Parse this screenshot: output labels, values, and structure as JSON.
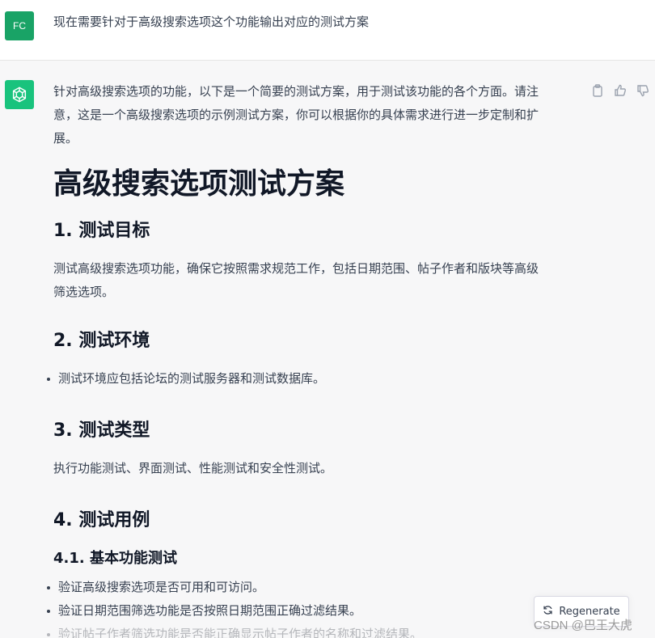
{
  "user": {
    "initials": "FC",
    "message": "现在需要针对于高级搜索选项这个功能输出对应的测试方案"
  },
  "assistant": {
    "intro_line1": "针对高级搜索选项的功能，以下是一个简要的测试方案，用于测试该功能的各个方面。请注",
    "intro_line2": "意，这是一个高级搜索选项的示例测试方案，你可以根据你的具体需求进行进一步定制和扩",
    "intro_line3": "展。",
    "title": "高级搜索选项测试方案",
    "sections": [
      {
        "heading": "1. 测试目标",
        "line1": "测试高级搜索选项功能，确保它按照需求规范工作，包括日期范围、帖子作者和版块等高级",
        "line2": "筛选选项。"
      },
      {
        "heading": "2. 测试环境",
        "bullet": "测试环境应包括论坛的测试服务器和测试数据库。"
      },
      {
        "heading": "3. 测试类型",
        "text": "执行功能测试、界面测试、性能测试和安全性测试。"
      },
      {
        "heading": "4. 测试用例",
        "subheading": "4.1. 基本功能测试",
        "bullets": [
          "验证高级搜索选项是否可用和可访问。",
          "验证日期范围筛选功能是否按照日期范围正确过滤结果。",
          "验证帖子作者筛选功能是否能正确显示帖子作者的名称和过滤结果。"
        ]
      }
    ]
  },
  "actions": {
    "icons": [
      "clipboard-icon",
      "thumbs-up-icon",
      "thumbs-down-icon"
    ]
  },
  "regenerate": {
    "label": "Regenerate",
    "icon": "refresh-icon"
  },
  "watermark": "CSDN @巴王大虎",
  "colors": {
    "user_avatar": "#19a366",
    "bot_avatar": "#19c37d",
    "assistant_bg": "#f7f7f8"
  }
}
